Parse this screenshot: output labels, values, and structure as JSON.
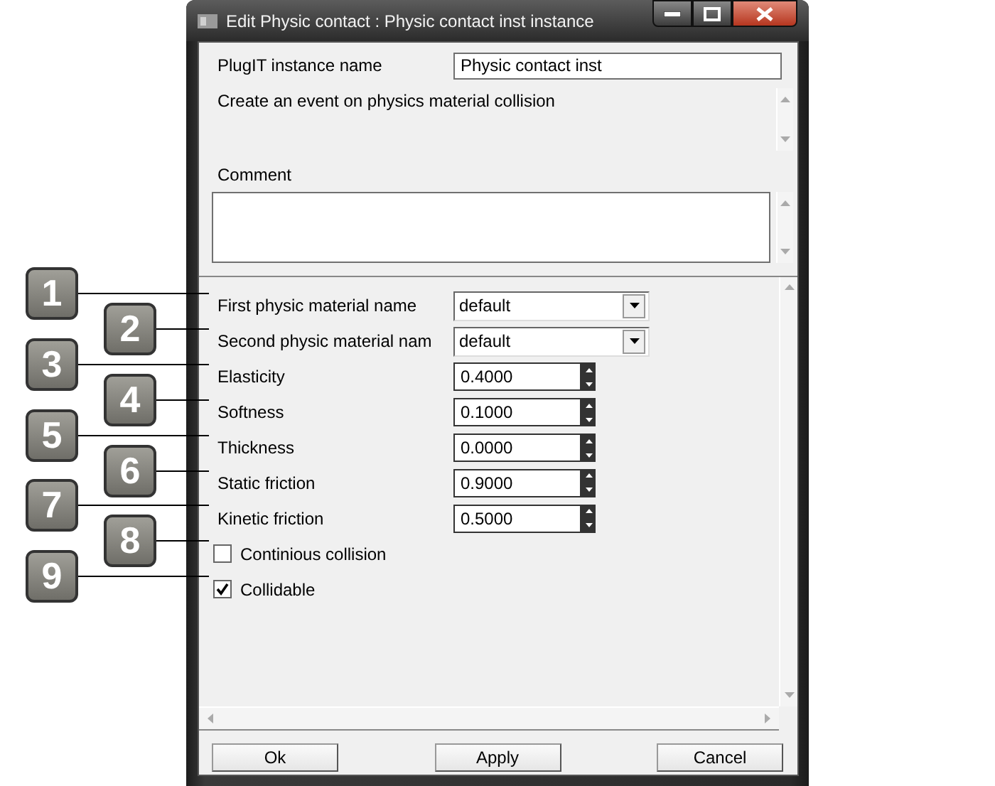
{
  "window": {
    "title": "Edit Physic contact : Physic contact inst instance"
  },
  "instance_name": {
    "label": "PlugIT instance name",
    "value": "Physic contact inst"
  },
  "description": "Create an event on physics material collision",
  "comment": {
    "label": "Comment"
  },
  "properties": [
    {
      "kind": "select",
      "label": "First physic material name",
      "value": "default"
    },
    {
      "kind": "select",
      "label": "Second physic material nam",
      "value": "default"
    },
    {
      "kind": "spin",
      "label": "Elasticity",
      "value": "0.4000"
    },
    {
      "kind": "spin",
      "label": "Softness",
      "value": "0.1000"
    },
    {
      "kind": "spin",
      "label": "Thickness",
      "value": "0.0000"
    },
    {
      "kind": "spin",
      "label": "Static friction",
      "value": "0.9000"
    },
    {
      "kind": "spin",
      "label": "Kinetic friction",
      "value": "0.5000"
    },
    {
      "kind": "checkbox",
      "label": "Continious collision",
      "checked": false
    },
    {
      "kind": "checkbox",
      "label": "Collidable",
      "checked": true
    }
  ],
  "callouts": [
    "1",
    "2",
    "3",
    "4",
    "5",
    "6",
    "7",
    "8",
    "9"
  ],
  "buttons": [
    "Ok",
    "Apply",
    "Cancel"
  ]
}
